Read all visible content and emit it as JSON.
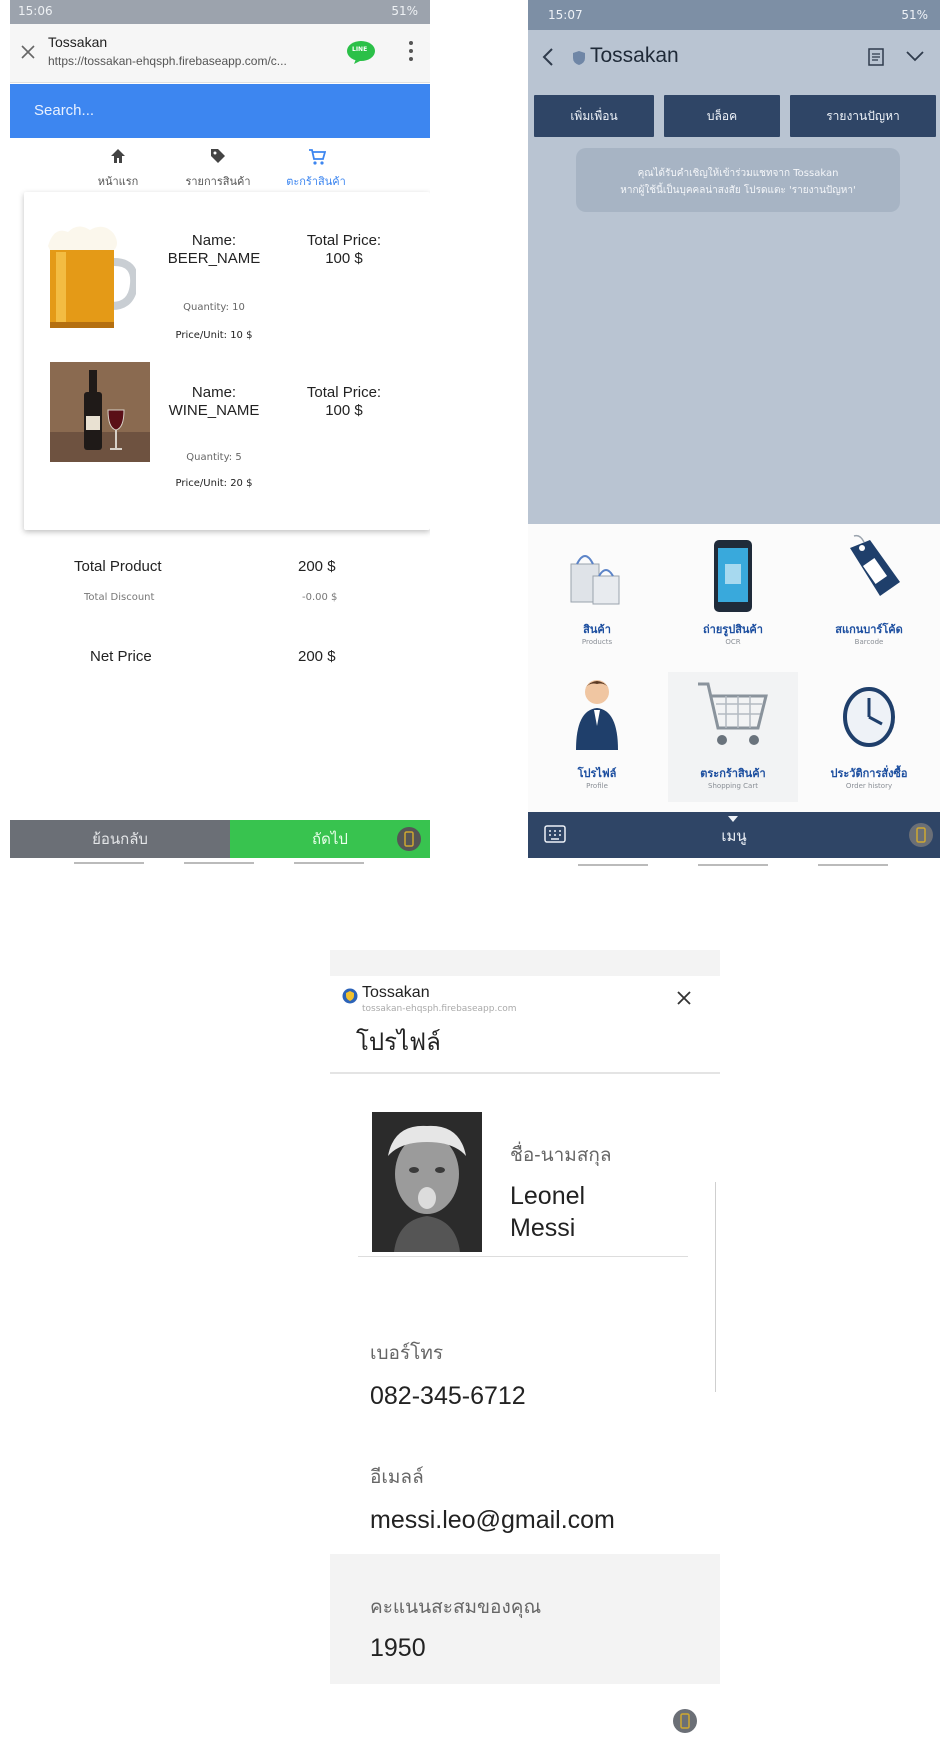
{
  "cart_screen": {
    "status_time": "15:06",
    "status_battery": "51%",
    "tab_title": "Tossakan",
    "tab_url": "https://tossakan-ehqsph.firebaseapp.com/c...",
    "line_badge": "LINE",
    "search_placeholder": "Search...",
    "nav": [
      "หน้าแรก",
      "รายการสินค้า",
      "ตะกร้าสินค้า"
    ],
    "items": [
      {
        "name_label": "Name:",
        "name": "BEER_NAME",
        "total_label": "Total Price:",
        "total": "100 $",
        "quantity": "Quantity: 10",
        "unit_price": "Price/Unit: 10 $"
      },
      {
        "name_label": "Name:",
        "name": "WINE_NAME",
        "total_label": "Total Price:",
        "total": "100 $",
        "quantity": "Quantity: 5",
        "unit_price": "Price/Unit: 20 $"
      }
    ],
    "summary": {
      "total_product_label": "Total Product",
      "total_product": "200 $",
      "total_discount_label": "Total Discount",
      "total_discount": "-0.00 $",
      "net_price_label": "Net Price",
      "net_price": "200 $"
    },
    "back_button": "ย้อนกลับ",
    "next_button": "ถัดไป"
  },
  "line_screen": {
    "status_time": "15:07",
    "status_battery": "51%",
    "chat_name": "Tossakan",
    "buttons": [
      "เพิ่มเพื่อน",
      "บล็อค",
      "รายงานปัญหา"
    ],
    "notice_line1": "คุณได้รับคำเชิญให้เข้าร่วมแชทจาก Tossakan",
    "notice_line2": "หากผู้ใช้นี้เป็นบุคคลน่าสงสัย โปรดแตะ 'รายงานปัญหา'",
    "menu": [
      {
        "label": "สินค้า",
        "sub": "Products"
      },
      {
        "label": "ถ่ายรูปสินค้า",
        "sub": "OCR"
      },
      {
        "label": "สแกนบาร์โค้ด",
        "sub": "Barcode"
      },
      {
        "label": "โปรไฟล์",
        "sub": "Profile"
      },
      {
        "label": "ตระกร้าสินค้า",
        "sub": "Shopping Cart"
      },
      {
        "label": "ประวัติการสั่งซื้อ",
        "sub": "Order history"
      }
    ],
    "menu_bar_label": "เมนู"
  },
  "profile_screen": {
    "app_name": "Tossakan",
    "app_url": "tossakan-ehqsph.firebaseapp.com",
    "page_title": "โปรไฟล์",
    "name_label": "ชื่อ-นามสกุล",
    "first_name": "Leonel",
    "last_name": "Messi",
    "phone_label": "เบอร์โทร",
    "phone": "082-345-6712",
    "email_label": "อีเมลล์",
    "email": "messi.leo@gmail.com",
    "points_label": "คะแนนสะสมของคุณ",
    "points": "1950"
  },
  "colors": {
    "search_blue": "#3d86f0",
    "next_green": "#38c34f",
    "line_navy": "#2f4566",
    "line_chat_bg": "#b9c4d2",
    "menu_label_blue": "#1d4fa0"
  }
}
